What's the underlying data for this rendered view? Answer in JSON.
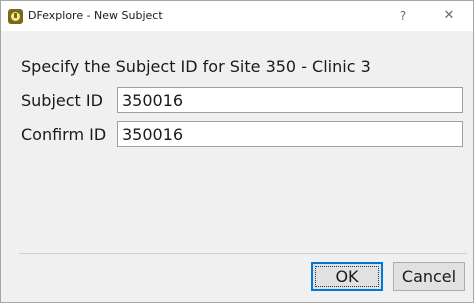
{
  "window": {
    "title": "DFexplore - New Subject",
    "help_glyph": "?",
    "close_glyph": "✕"
  },
  "form": {
    "prompt": "Specify the Subject ID for Site 350 - Clinic 3",
    "subject_id_label": "Subject ID",
    "subject_id_value": "350016",
    "confirm_id_label": "Confirm ID",
    "confirm_id_value": "350016"
  },
  "buttons": {
    "ok_label": "OK",
    "cancel_label": "Cancel"
  },
  "icons": {
    "app": "dfexplore-app-icon",
    "help": "help-icon",
    "close": "close-icon"
  }
}
